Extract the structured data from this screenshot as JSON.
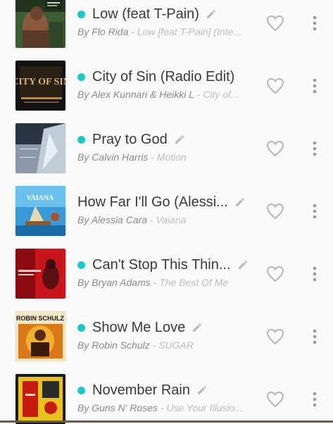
{
  "songs": [
    {
      "title": "Low (feat T-Pain)",
      "artist": "By Flo Rida",
      "album": " - Low [feat T-Pain] (Inte...",
      "playing": true,
      "editable": true
    },
    {
      "title": "City of Sin (Radio Edit)",
      "artist": "By Alex Kunnari & Heikki L",
      "album": " - City of...",
      "playing": true,
      "editable": false
    },
    {
      "title": "Pray to God",
      "artist": "By Calvin Harris",
      "album": " - Motion",
      "playing": true,
      "editable": true
    },
    {
      "title": "How Far I'll Go (Alessi...",
      "artist": "By Alessia Cara",
      "album": " - Vaiana",
      "playing": false,
      "editable": true
    },
    {
      "title": "Can't Stop This Thin...",
      "artist": "By Bryan Adams",
      "album": " - The Best Of Me",
      "playing": true,
      "editable": true
    },
    {
      "title": "Show Me Love",
      "artist": "By Robin Schulz",
      "album": " - SUGAR",
      "playing": true,
      "editable": true
    },
    {
      "title": "November Rain",
      "artist": "By Guns N' Roses",
      "album": " - Use Your Illusio...",
      "playing": true,
      "editable": true
    }
  ],
  "art_text": {
    "city_of_sin": "CITY OF SIN",
    "vaiana": "VAIANA",
    "robin_schulz": "ROBIN SCHULZ"
  },
  "colors": {
    "accent_dot": "#1ec8c8",
    "title": "#3a3a3a",
    "artist": "#8a8a8a",
    "album": "#bdbdbd",
    "icon": "#b5b5b5"
  },
  "icons": {
    "heart": "heart-outline-icon",
    "more": "more-vert-icon",
    "pencil": "edit-pencil-icon"
  }
}
